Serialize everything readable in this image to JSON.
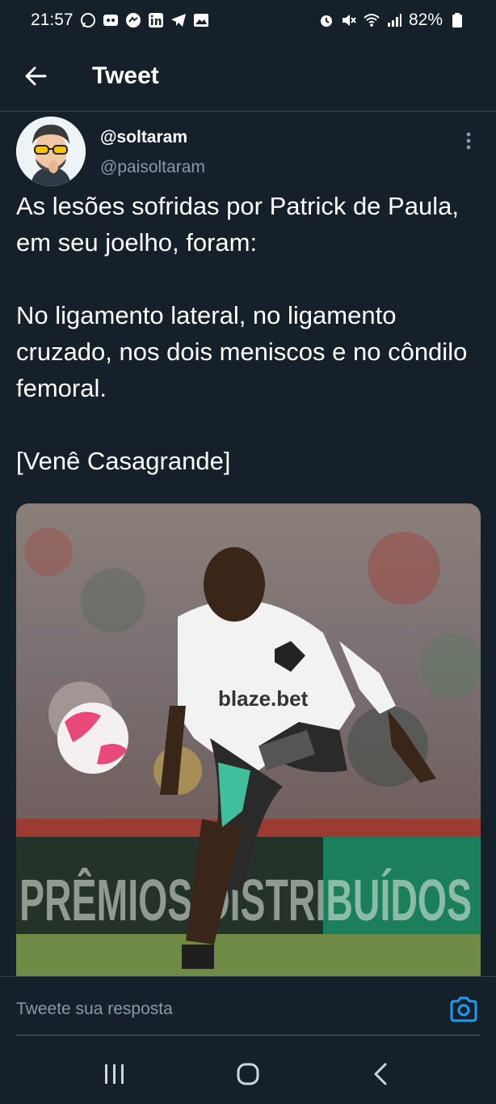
{
  "status_bar": {
    "time": "21:57",
    "battery": "82%",
    "left_icons": [
      "whatsapp-icon",
      "voicemail-icon",
      "messenger-icon",
      "linkedin-icon",
      "telegram-icon",
      "gallery-icon"
    ],
    "right_icons": [
      "alarm-icon",
      "mute-icon",
      "wifi-icon",
      "signal-icon",
      "battery-icon"
    ]
  },
  "app_bar": {
    "title": "Tweet"
  },
  "tweet": {
    "display_name": "@soltaram",
    "handle": "@paisoltaram",
    "text": "As lesões sofridas por Patrick de Paula, em seu joelho, foram:\n\nNo ligamento lateral, no ligamento cruzado, nos dois meniscos e no côndilo femoral.\n\n[Venê Casagrande]",
    "media_banner_text": "PRÊMIOS DISTRIBUÍDOS",
    "jersey_sponsor": "blaze.bet"
  },
  "reply": {
    "placeholder": "Tweete sua resposta"
  },
  "colors": {
    "background": "#15202b",
    "divider": "#38444d",
    "secondary_text": "#8899a6",
    "accent": "#1d9bf0"
  }
}
